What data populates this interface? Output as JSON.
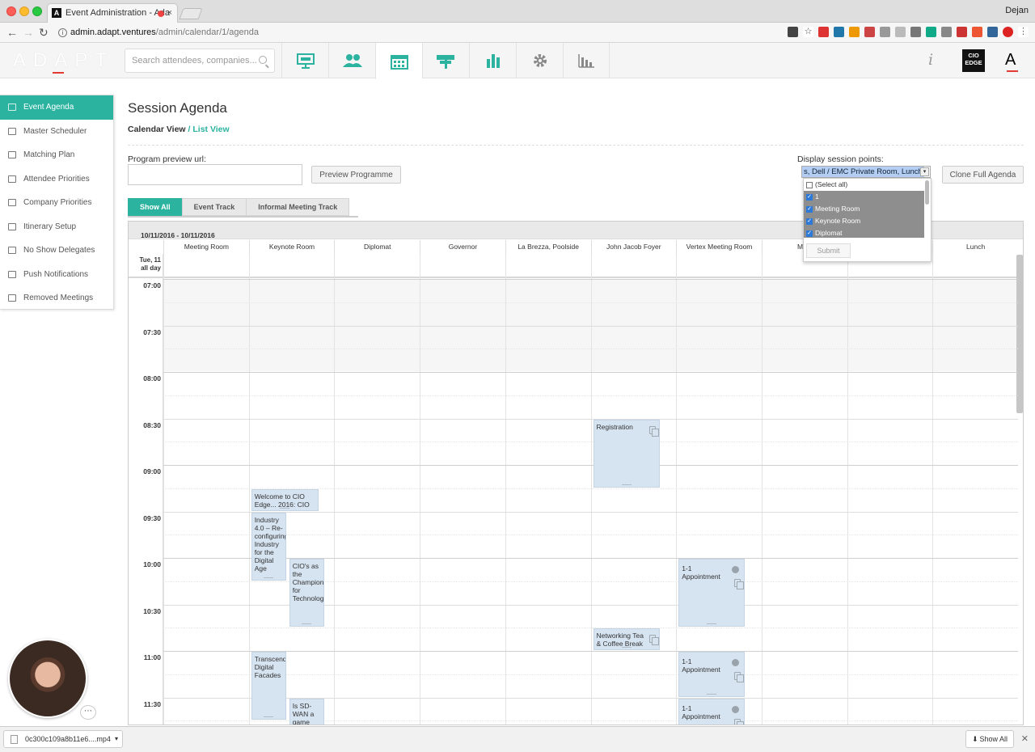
{
  "browser": {
    "tab_title": "Event Administration - Ada",
    "user": "Dejan",
    "url_host": "admin.adapt.ventures",
    "url_path": "/admin/calendar/1/agenda"
  },
  "header": {
    "logo": "ADAPT",
    "search_placeholder": "Search attendees, companies...",
    "nav": [
      {
        "name": "presentation",
        "glyph": "▣"
      },
      {
        "name": "attendees",
        "glyph": "☻"
      },
      {
        "name": "calendar",
        "glyph": "▦"
      },
      {
        "name": "signpost",
        "glyph": "⊤"
      },
      {
        "name": "stats",
        "glyph": "▮"
      },
      {
        "name": "settings",
        "glyph": "⚙"
      },
      {
        "name": "reports",
        "glyph": "▯"
      }
    ],
    "info_glyph": "i",
    "cio_badge": "CIO\nEDGE",
    "brand_letter": "A"
  },
  "sidebar": {
    "items": [
      {
        "label": "Event Agenda",
        "active": true
      },
      {
        "label": "Master Scheduler"
      },
      {
        "label": "Matching Plan"
      },
      {
        "label": "Attendee Priorities"
      },
      {
        "label": "Company Priorities"
      },
      {
        "label": "Itinerary Setup"
      },
      {
        "label": "No Show Delegates"
      },
      {
        "label": "Push Notifications"
      },
      {
        "label": "Removed Meetings"
      }
    ]
  },
  "main": {
    "title": "Session Agenda",
    "calendar_view": "Calendar View",
    "separator": " / ",
    "list_view": "List View",
    "program_preview_label": "Program preview url:",
    "program_preview_value": "",
    "preview_button": "Preview Programme",
    "display_points_label": "Display session points:",
    "display_points_value": "s, Dell / EMC Private Room, Lunch",
    "clone_button": "Clone Full Agenda",
    "dropdown": {
      "options": [
        {
          "label": "(Select all)",
          "checked": false
        },
        {
          "label": "1",
          "checked": true
        },
        {
          "label": "Meeting Room",
          "checked": true
        },
        {
          "label": "Keynote Room",
          "checked": true
        },
        {
          "label": "Diplomat",
          "checked": true
        }
      ],
      "submit": "Submit"
    },
    "filters": [
      {
        "label": "Show All",
        "active": true
      },
      {
        "label": "Event Track"
      },
      {
        "label": "Informal Meeting Track"
      }
    ]
  },
  "calendar": {
    "date_range": "10/11/2016 - 10/11/2016",
    "allday_label": "Tue, 11\nall day",
    "columns": [
      "Meeting Room",
      "Keynote Room",
      "Diplomat",
      "Governor",
      "La Brezza, Poolside",
      "John Jacob Foyer",
      "Vertex Meeting Room",
      "Main",
      "",
      "Lunch"
    ],
    "times": [
      "07:00",
      "07:30",
      "08:00",
      "08:30",
      "09:00",
      "09:30",
      "10:00",
      "10:30",
      "11:00",
      "11:30"
    ],
    "events": [
      {
        "title": "Registration",
        "col": 5,
        "start": "08:30",
        "end": "09:15"
      },
      {
        "title": "Welcome to CIO Edge... 2016: CIO",
        "col": 1,
        "start": "09:15",
        "end": "09:30",
        "narrow": true
      },
      {
        "title": "Industry 4.0 – Re-configuring Industry for the Digital Age",
        "col": 1,
        "start": "09:30",
        "end": "10:15",
        "narrow": true
      },
      {
        "title": "CIO's as the Champions for Technology",
        "col": 1,
        "start": "10:00",
        "end": "10:45",
        "right": true
      },
      {
        "title": "1-1 Appointment",
        "col": 6,
        "start": "10:00",
        "end": "10:45",
        "type": "appointment"
      },
      {
        "title": "Networking Tea & Coffee Break",
        "col": 5,
        "start": "10:45",
        "end": "11:00"
      },
      {
        "title": "Transcend Digital Facades",
        "col": 1,
        "start": "11:00",
        "end": "11:45",
        "narrow": true
      },
      {
        "title": "1-1 Appointment",
        "col": 6,
        "start": "11:00",
        "end": "11:30",
        "type": "appointment"
      },
      {
        "title": "Is SD-WAN a game",
        "col": 1,
        "start": "11:30",
        "end": "12:00",
        "right": true
      },
      {
        "title": "1-1 Appointment",
        "col": 6,
        "start": "11:30",
        "end": "12:00",
        "type": "appointment"
      }
    ]
  },
  "downloads": {
    "file": "0c300c109a8b11e6....mp4",
    "show_all": "Show All"
  },
  "colors": {
    "accent": "#2bb3a0",
    "event_bg": "#d6e3f0",
    "logo_red": "#e53935"
  }
}
